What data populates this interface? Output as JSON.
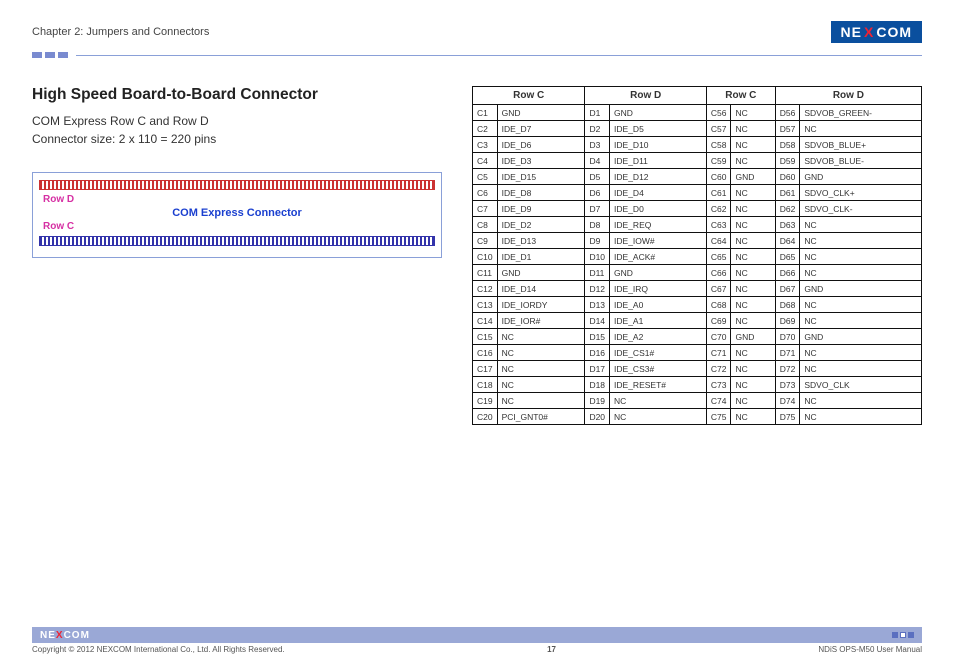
{
  "header": {
    "chapter": "Chapter 2: Jumpers and Connectors",
    "logo_pre": "NE",
    "logo_x": "X",
    "logo_post": "COM"
  },
  "section": {
    "heading": "High Speed Board-to-Board Connector",
    "line1": "COM Express Row C and Row D",
    "line2": "Connector size: 2 x 110 = 220 pins"
  },
  "diagram": {
    "row_d": "Row D",
    "center": "COM Express Connector",
    "row_c": "Row C"
  },
  "table": {
    "headers": [
      "Row C",
      "Row D",
      "Row C",
      "Row D"
    ],
    "rows": [
      [
        "C1",
        "GND",
        "D1",
        "GND",
        "C56",
        "NC",
        "D56",
        "SDVOB_GREEN-"
      ],
      [
        "C2",
        "IDE_D7",
        "D2",
        "IDE_D5",
        "C57",
        "NC",
        "D57",
        "NC"
      ],
      [
        "C3",
        "IDE_D6",
        "D3",
        "IDE_D10",
        "C58",
        "NC",
        "D58",
        "SDVOB_BLUE+"
      ],
      [
        "C4",
        "IDE_D3",
        "D4",
        "IDE_D11",
        "C59",
        "NC",
        "D59",
        "SDVOB_BLUE-"
      ],
      [
        "C5",
        "IDE_D15",
        "D5",
        "IDE_D12",
        "C60",
        "GND",
        "D60",
        "GND"
      ],
      [
        "C6",
        "IDE_D8",
        "D6",
        "IDE_D4",
        "C61",
        "NC",
        "D61",
        "SDVO_CLK+"
      ],
      [
        "C7",
        "IDE_D9",
        "D7",
        "IDE_D0",
        "C62",
        "NC",
        "D62",
        "SDVO_CLK-"
      ],
      [
        "C8",
        "IDE_D2",
        "D8",
        "IDE_REQ",
        "C63",
        "NC",
        "D63",
        "NC"
      ],
      [
        "C9",
        "IDE_D13",
        "D9",
        "IDE_IOW#",
        "C64",
        "NC",
        "D64",
        "NC"
      ],
      [
        "C10",
        "IDE_D1",
        "D10",
        "IDE_ACK#",
        "C65",
        "NC",
        "D65",
        "NC"
      ],
      [
        "C11",
        "GND",
        "D11",
        "GND",
        "C66",
        "NC",
        "D66",
        "NC"
      ],
      [
        "C12",
        "IDE_D14",
        "D12",
        "IDE_IRQ",
        "C67",
        "NC",
        "D67",
        "GND"
      ],
      [
        "C13",
        "IDE_IORDY",
        "D13",
        "IDE_A0",
        "C68",
        "NC",
        "D68",
        "NC"
      ],
      [
        "C14",
        "IDE_IOR#",
        "D14",
        "IDE_A1",
        "C69",
        "NC",
        "D69",
        "NC"
      ],
      [
        "C15",
        "NC",
        "D15",
        "IDE_A2",
        "C70",
        "GND",
        "D70",
        "GND"
      ],
      [
        "C16",
        "NC",
        "D16",
        "IDE_CS1#",
        "C71",
        "NC",
        "D71",
        "NC"
      ],
      [
        "C17",
        "NC",
        "D17",
        "IDE_CS3#",
        "C72",
        "NC",
        "D72",
        "NC"
      ],
      [
        "C18",
        "NC",
        "D18",
        "IDE_RESET#",
        "C73",
        "NC",
        "D73",
        "SDVO_CLK"
      ],
      [
        "C19",
        "NC",
        "D19",
        "NC",
        "C74",
        "NC",
        "D74",
        "NC"
      ],
      [
        "C20",
        "PCI_GNT0#",
        "D20",
        "NC",
        "C75",
        "NC",
        "D75",
        "NC"
      ]
    ]
  },
  "footer": {
    "logo_pre": "NE",
    "logo_x": "X",
    "logo_post": "COM",
    "copyright": "Copyright © 2012 NEXCOM International Co., Ltd. All Rights Reserved.",
    "page": "17",
    "manual": "NDiS OPS-M50 User Manual"
  }
}
